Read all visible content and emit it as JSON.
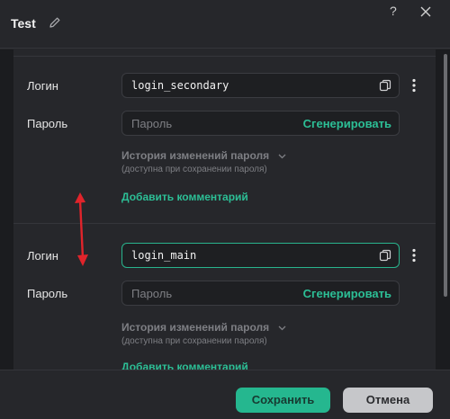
{
  "window": {
    "title": "Test",
    "help": "?"
  },
  "entries": [
    {
      "login_label": "Логин",
      "login_value": "login_secondary",
      "password_label": "Пароль",
      "password_placeholder": "Пароль",
      "generate_label": "Сгенерировать",
      "history_label": "История изменений пароля",
      "history_note": "(доступна при сохранении пароля)",
      "add_comment_label": "Добавить комментарий"
    },
    {
      "login_label": "Логин",
      "login_value": "login_main",
      "password_label": "Пароль",
      "password_placeholder": "Пароль",
      "generate_label": "Сгенерировать",
      "history_label": "История изменений пароля",
      "history_note": "(доступна при сохранении пароля)",
      "add_comment_label": "Добавить комментарий"
    }
  ],
  "footer": {
    "save_label": "Сохранить",
    "cancel_label": "Отмена"
  },
  "colors": {
    "accent": "#2cbf96",
    "annotation": "#e0242b"
  },
  "icons": [
    "pencil-icon",
    "help-icon",
    "close-icon",
    "copy-icon",
    "kebab-menu-icon",
    "chevron-down-icon",
    "double-arrow-icon"
  ]
}
